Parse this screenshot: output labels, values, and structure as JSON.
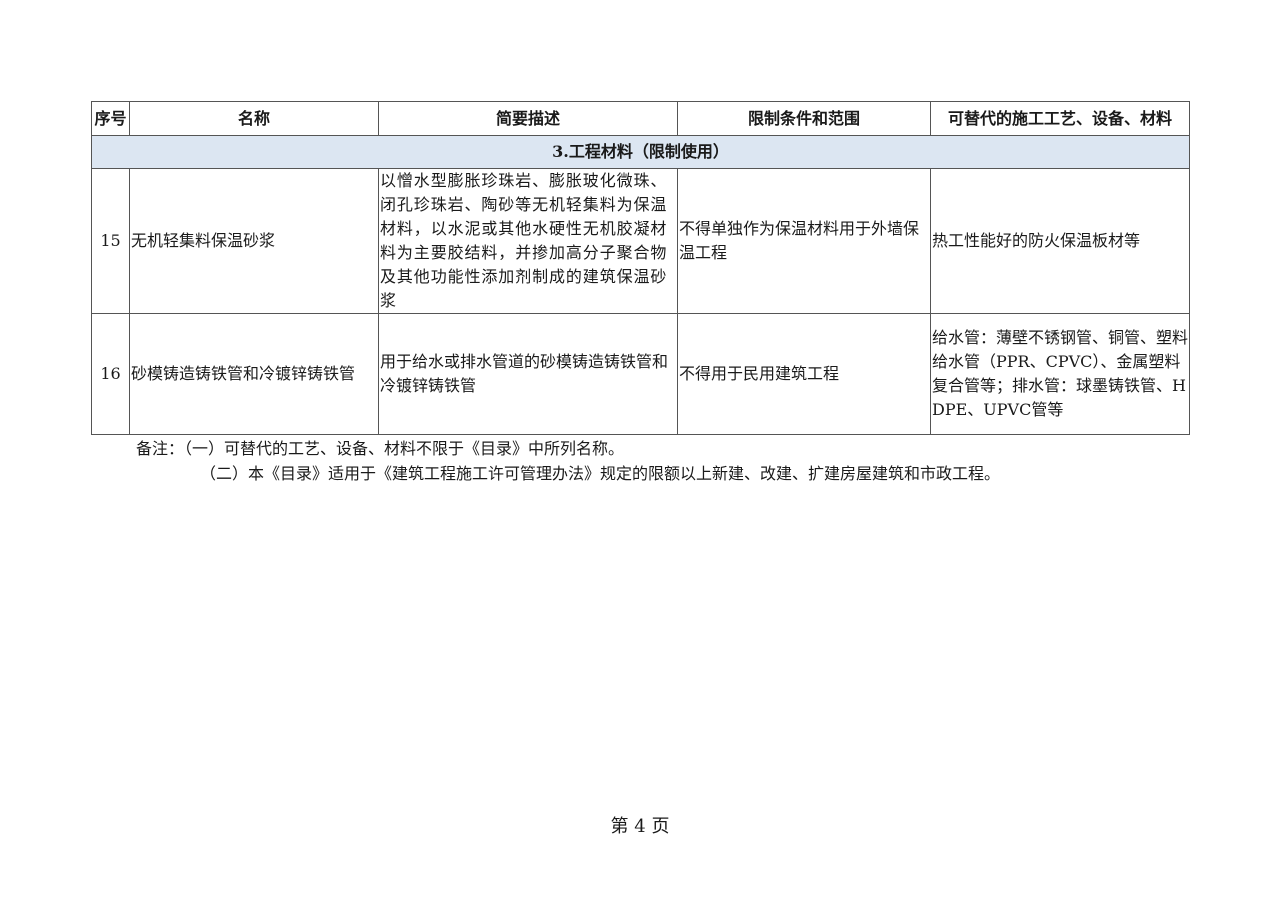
{
  "table": {
    "headers": [
      "序号",
      "名称",
      "简要描述",
      "限制条件和范围",
      "可替代的施工工艺、设备、材料"
    ],
    "section_title": "3.工程材料（限制使用）",
    "rows": [
      {
        "seq": "15",
        "name": "无机轻集料保温砂浆",
        "description": "以憎水型膨胀珍珠岩、膨胀玻化微珠、闭孔珍珠岩、陶砂等无机轻集料为保温材料，以水泥或其他水硬性无机胶凝材料为主要胶结料，并掺加高分子聚合物及其他功能性添加剂制成的建筑保温砂浆",
        "restriction": "不得单独作为保温材料用于外墙保温工程",
        "alternative": "热工性能好的防火保温板材等"
      },
      {
        "seq": "16",
        "name": "砂模铸造铸铁管和冷镀锌铸铁管",
        "description": "用于给水或排水管道的砂模铸造铸铁管和冷镀锌铸铁管",
        "restriction": "不得用于民用建筑工程",
        "alternative": "给水管：薄壁不锈钢管、铜管、塑料给水管（PPR、CPVC）、金属塑料复合管等；排水管：球墨铸铁管、HDPE、UPVC管等"
      }
    ]
  },
  "notes": {
    "line1": "备注：（一）可替代的工艺、设备、材料不限于《目录》中所列名称。",
    "line2": "（二）本《目录》适用于《建筑工程施工许可管理办法》规定的限额以上新建、改建、扩建房屋建筑和市政工程。"
  },
  "footer": {
    "page_label": "第 4 页"
  }
}
